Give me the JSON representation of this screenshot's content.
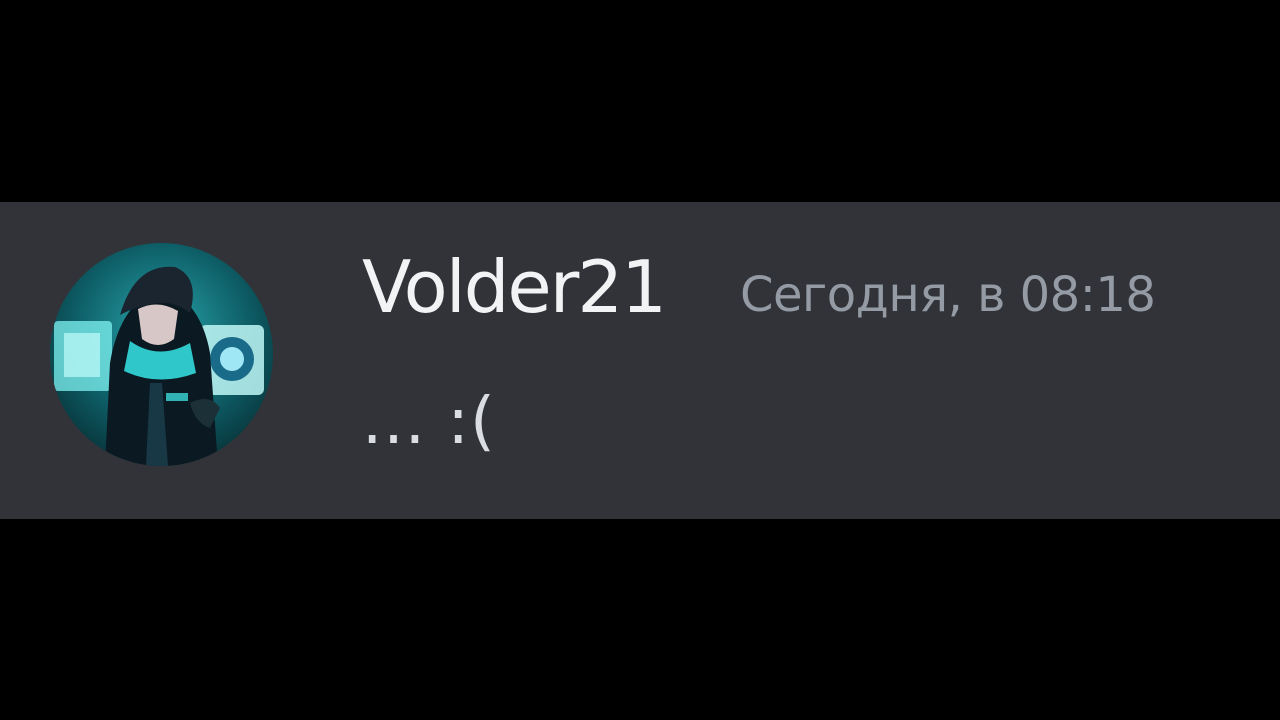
{
  "message": {
    "author": {
      "username": "Volder21",
      "avatar_icon": "anime-character-avatar"
    },
    "timestamp": "Сегодня, в 08:18",
    "content": "... :("
  },
  "colors": {
    "background": "#000000",
    "message_background": "#313338",
    "username": "#f2f3f5",
    "timestamp": "#949ba4",
    "content": "#dbdee1",
    "avatar_accent": "#38d6d8"
  }
}
